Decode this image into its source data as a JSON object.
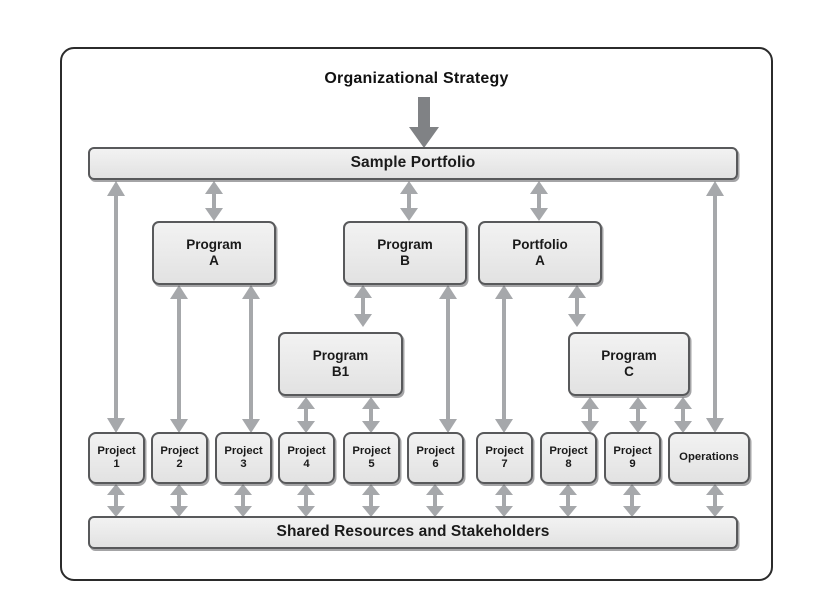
{
  "diagram": {
    "title": "Organizational Strategy",
    "portfolio_bar": "Sample Portfolio",
    "shared_bar": "Shared Resources and Stakeholders",
    "colors": {
      "frame_border": "#2b2b2b",
      "box_border": "#58595b",
      "box_fill": "#ebebeb",
      "arrow": "#a6a8ab",
      "text": "#1a1a1a"
    },
    "programs": [
      {
        "id": "program-a",
        "label": "Program\nA"
      },
      {
        "id": "program-b",
        "label": "Program\nB"
      },
      {
        "id": "portfolio-a",
        "label": "Portfolio\nA"
      },
      {
        "id": "program-b1",
        "label": "Program\nB1"
      },
      {
        "id": "program-c",
        "label": "Program\nC"
      }
    ],
    "projects": [
      {
        "id": "project-1",
        "label": "Project\n1"
      },
      {
        "id": "project-2",
        "label": "Project\n2"
      },
      {
        "id": "project-3",
        "label": "Project\n3"
      },
      {
        "id": "project-4",
        "label": "Project\n4"
      },
      {
        "id": "project-5",
        "label": "Project\n5"
      },
      {
        "id": "project-6",
        "label": "Project\n6"
      },
      {
        "id": "project-7",
        "label": "Project\n7"
      },
      {
        "id": "project-8",
        "label": "Project\n8"
      },
      {
        "id": "project-9",
        "label": "Project\n9"
      },
      {
        "id": "operations",
        "label": "Operations"
      }
    ],
    "connections": [
      "portfolio-to-project-1",
      "portfolio-to-program-a",
      "portfolio-to-program-b",
      "portfolio-to-portfolio-a",
      "portfolio-to-operations",
      "program-a-to-project-2",
      "program-a-to-project-3",
      "program-b-to-program-b1",
      "program-b-to-project-6",
      "program-b1-to-project-4",
      "program-b1-to-project-5",
      "portfolio-a-to-project-7",
      "portfolio-a-to-program-c",
      "program-c-to-project-8",
      "program-c-to-project-9",
      "program-c-to-operations"
    ]
  }
}
